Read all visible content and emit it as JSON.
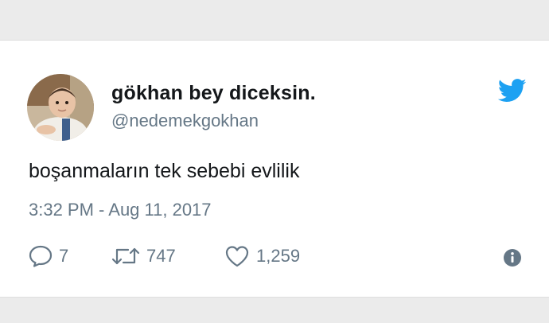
{
  "tweet": {
    "author": {
      "display_name": "gökhan bey diceksin.",
      "handle": "@nedemekgokhan",
      "avatar": "baby-photo-avatar"
    },
    "text": "boşanmaların tek sebebi evlilik",
    "timestamp": "3:32 PM - Aug 11, 2017",
    "stats": {
      "replies": "7",
      "retweets": "747",
      "likes": "1,259"
    }
  },
  "icons": {
    "brand": "twitter-bird-icon",
    "reply": "speech-bubble-icon",
    "retweet": "retweet-arrows-icon",
    "like": "heart-icon",
    "info": "info-icon"
  },
  "colors": {
    "background": "#ebebeb",
    "card": "#ffffff",
    "brand": "#1da1f2",
    "text": "#14171a",
    "secondary_text": "#657786"
  }
}
